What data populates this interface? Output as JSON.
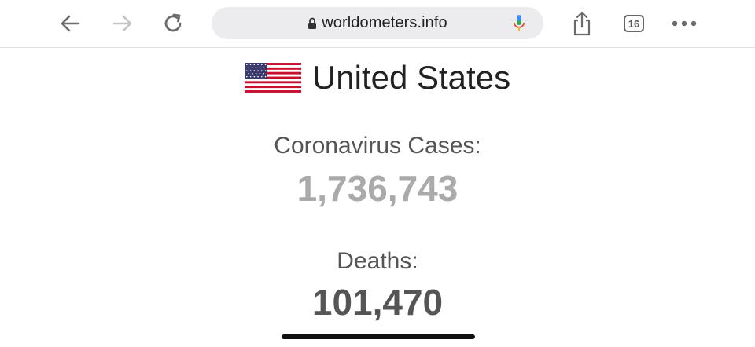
{
  "browser": {
    "url": "worldometers.info",
    "tab_count": "16",
    "icons": [
      "back-arrow-icon",
      "forward-arrow-icon",
      "reload-icon",
      "lock-icon",
      "microphone-icon",
      "share-icon",
      "tabs-icon",
      "more-icon"
    ]
  },
  "page": {
    "country": "United States",
    "cases_label": "Coronavirus Cases:",
    "cases_value": "1,736,743",
    "deaths_label": "Deaths:",
    "deaths_value": "101,470"
  },
  "colors": {
    "cases_value": "#aaaaaa",
    "deaths_value": "#555555",
    "label": "#555555",
    "flag_red": "#c8102e",
    "flag_blue": "#3c3b6e"
  }
}
